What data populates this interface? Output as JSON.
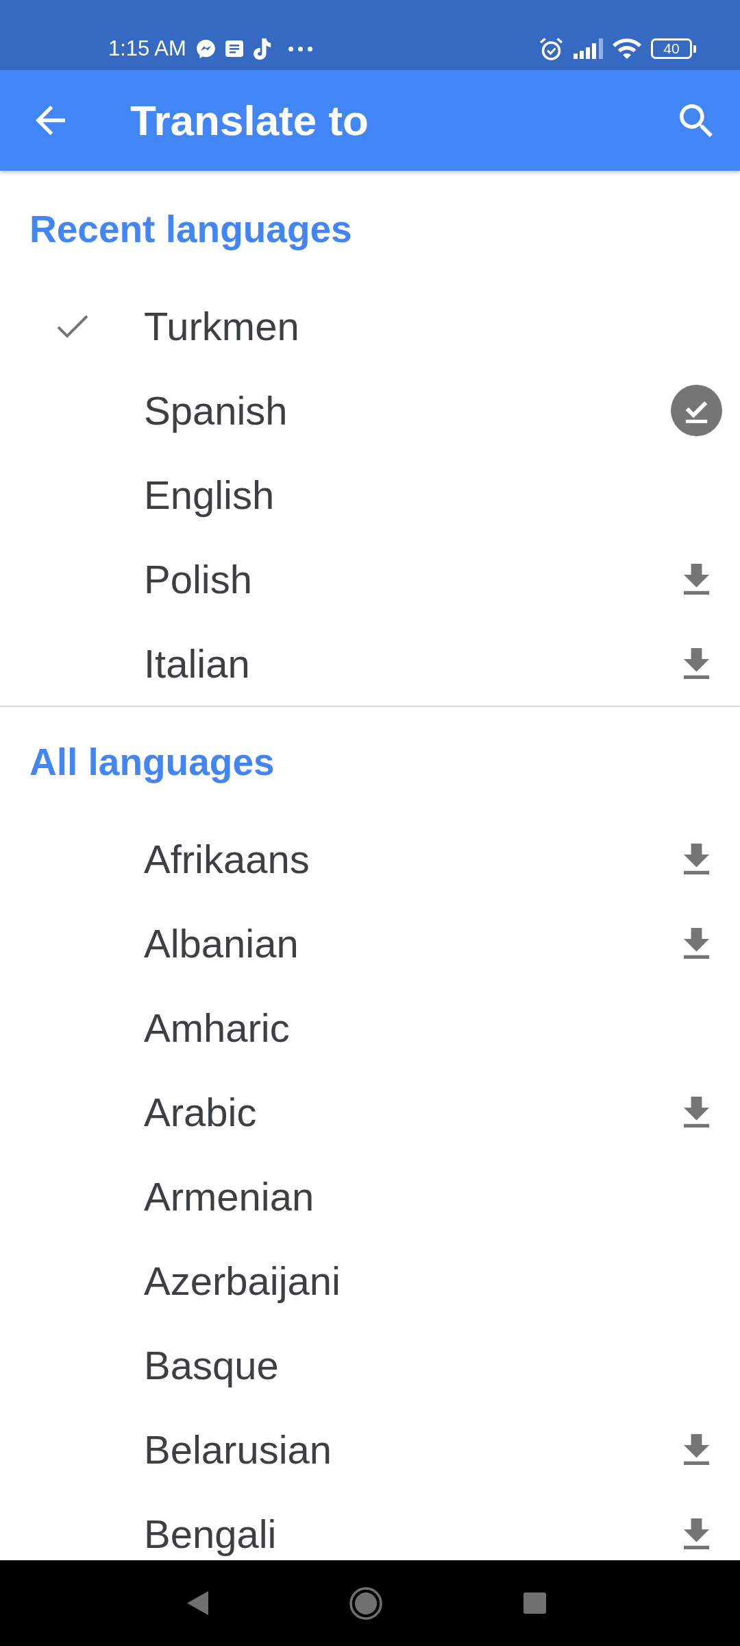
{
  "status_bar": {
    "time": "1:15 AM",
    "battery": "40"
  },
  "app_bar": {
    "title": "Translate to"
  },
  "sections": [
    {
      "title": "Recent languages",
      "languages": [
        {
          "name": "Turkmen",
          "selected": true,
          "kind": "plain"
        },
        {
          "name": "Spanish",
          "selected": false,
          "kind": "downloaded"
        },
        {
          "name": "English",
          "selected": false,
          "kind": "plain"
        },
        {
          "name": "Polish",
          "selected": false,
          "kind": "downloadable"
        },
        {
          "name": "Italian",
          "selected": false,
          "kind": "downloadable"
        }
      ]
    },
    {
      "title": "All languages",
      "languages": [
        {
          "name": "Afrikaans",
          "selected": false,
          "kind": "downloadable"
        },
        {
          "name": "Albanian",
          "selected": false,
          "kind": "downloadable"
        },
        {
          "name": "Amharic",
          "selected": false,
          "kind": "plain"
        },
        {
          "name": "Arabic",
          "selected": false,
          "kind": "downloadable"
        },
        {
          "name": "Armenian",
          "selected": false,
          "kind": "plain"
        },
        {
          "name": "Azerbaijani",
          "selected": false,
          "kind": "plain"
        },
        {
          "name": "Basque",
          "selected": false,
          "kind": "plain"
        },
        {
          "name": "Belarusian",
          "selected": false,
          "kind": "downloadable"
        },
        {
          "name": "Bengali",
          "selected": false,
          "kind": "downloadable"
        }
      ]
    }
  ]
}
